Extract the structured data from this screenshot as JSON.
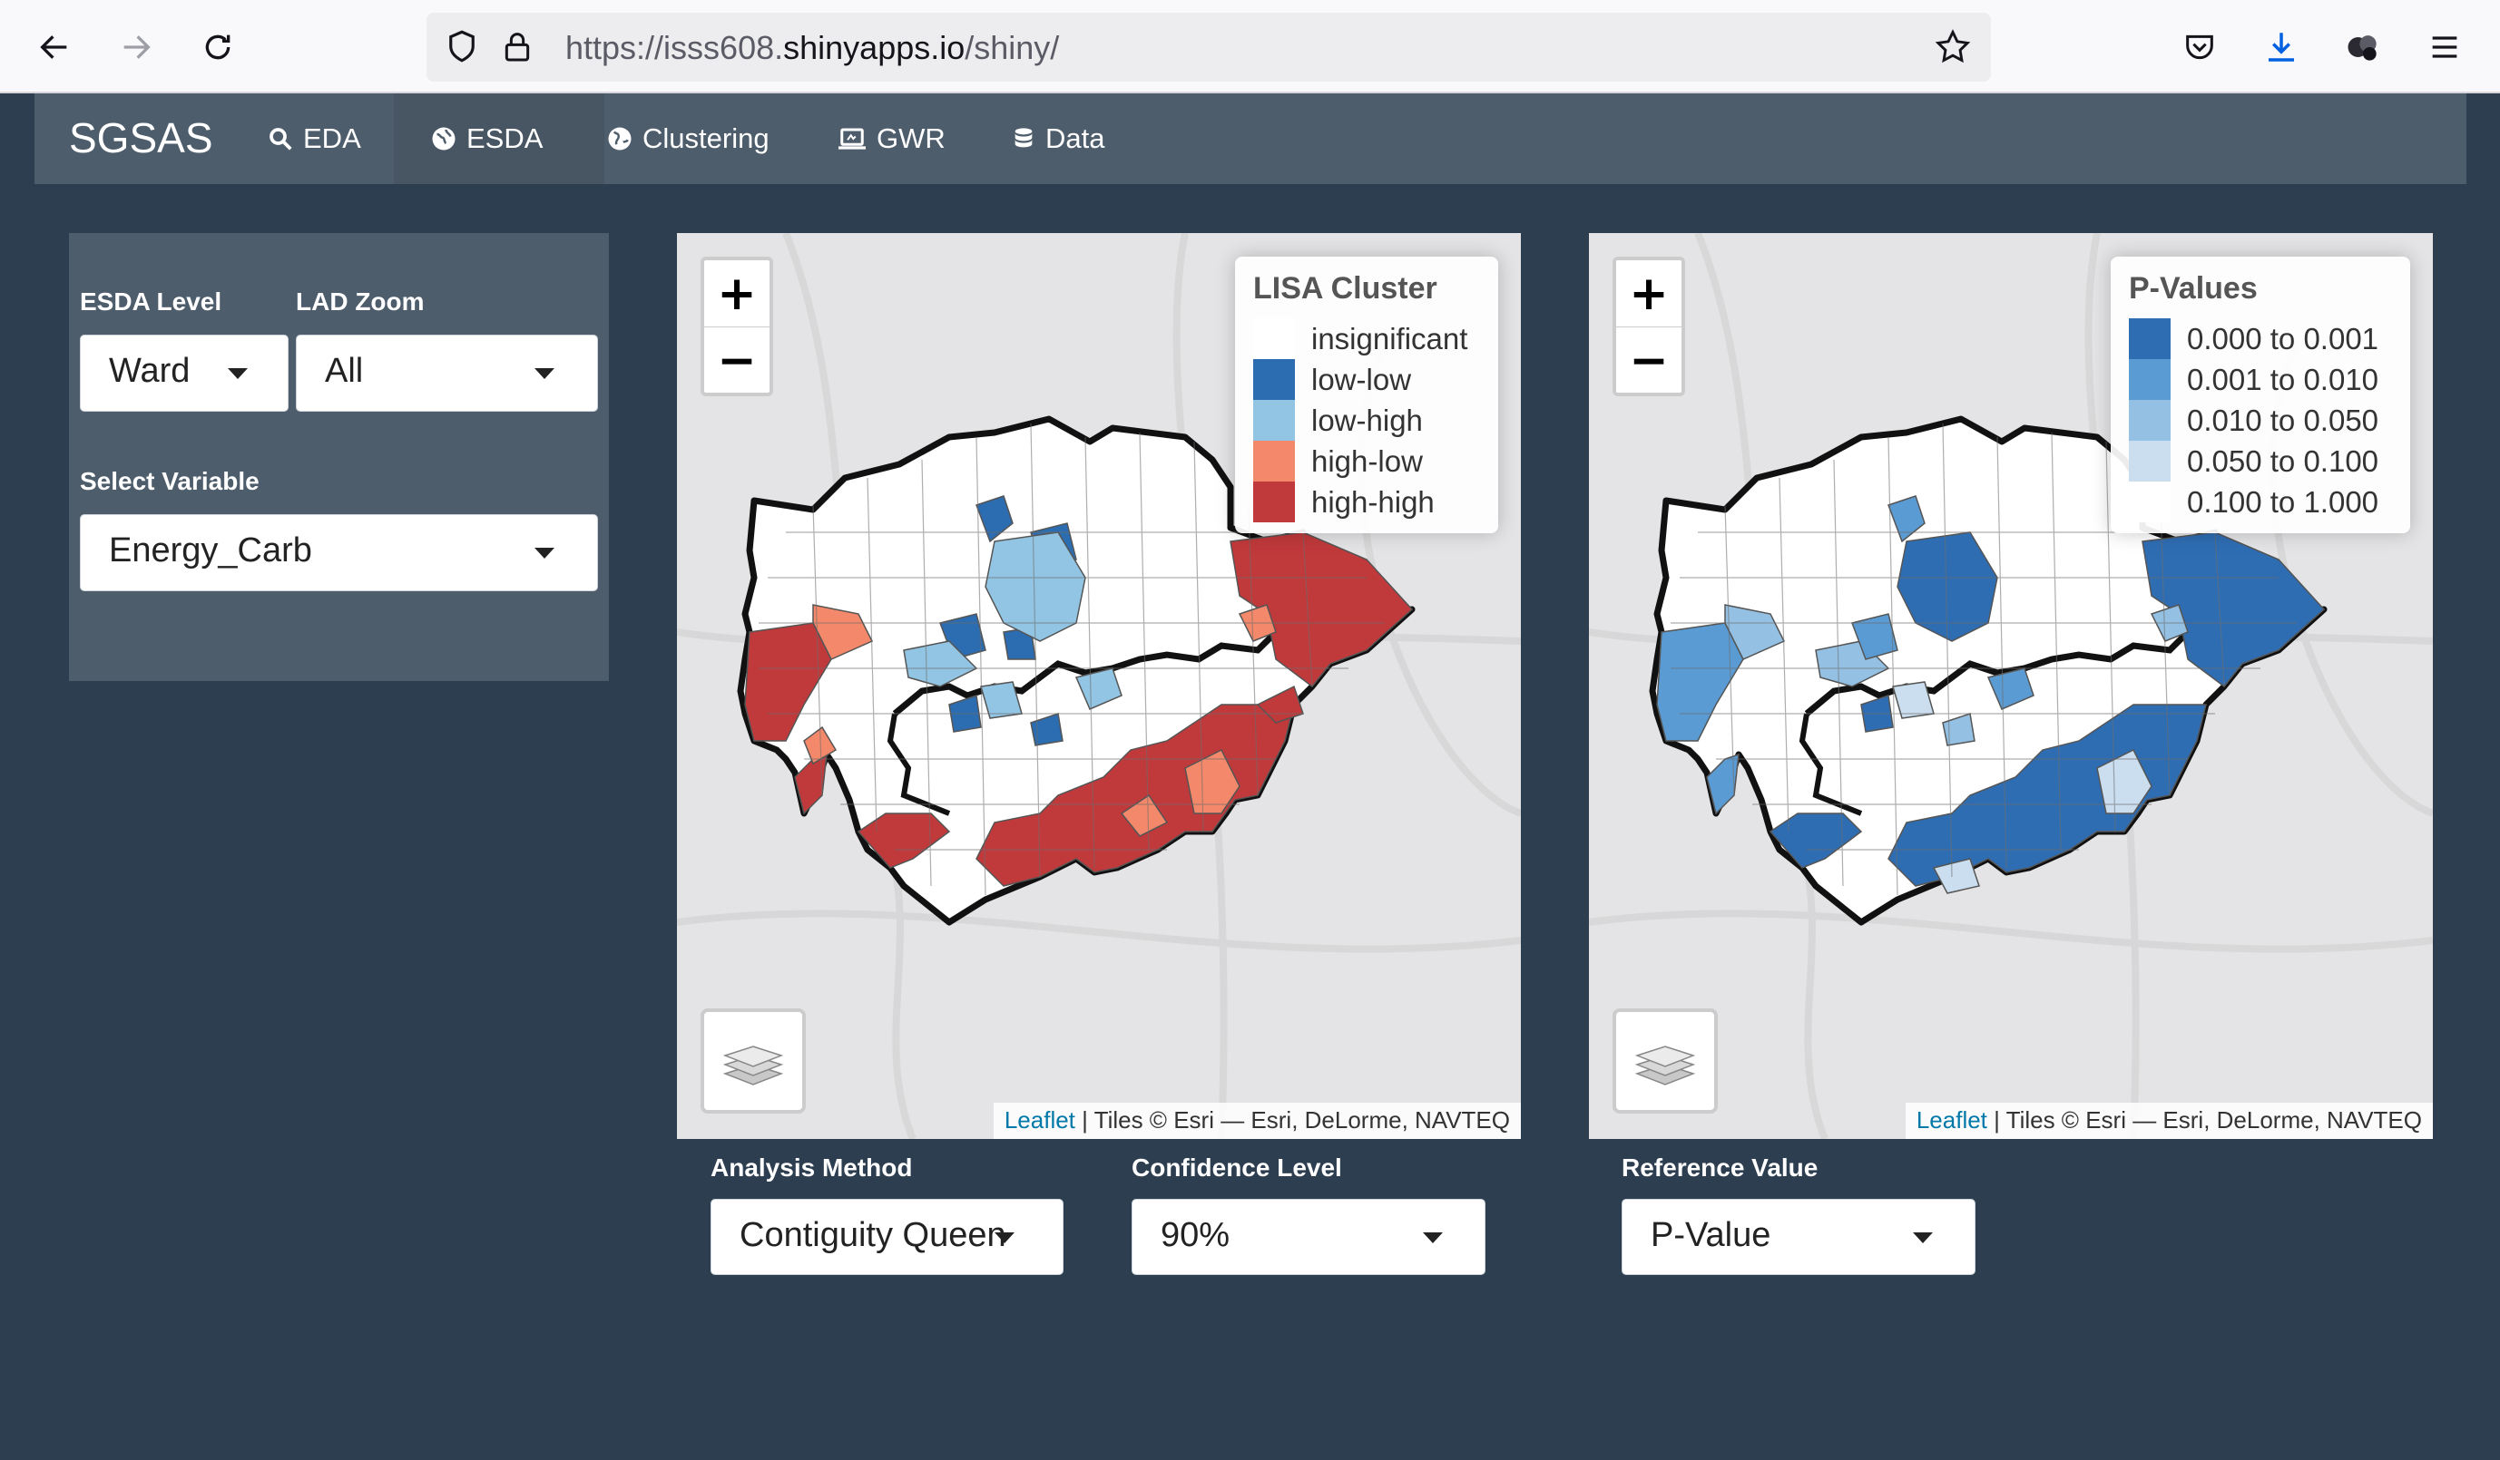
{
  "browser": {
    "url_prefix": "https://isss608.",
    "url_host": "shinyapps.io",
    "url_path": "/shiny/"
  },
  "navbar": {
    "brand": "SGSAS",
    "items": [
      {
        "label": "EDA",
        "icon": "search-icon"
      },
      {
        "label": "ESDA",
        "icon": "globe-icon",
        "active": true
      },
      {
        "label": "Clustering",
        "icon": "globe-americas-icon"
      },
      {
        "label": "GWR",
        "icon": "laptop-icon"
      },
      {
        "label": "Data",
        "icon": "database-icon"
      }
    ]
  },
  "sidebar": {
    "esda_level_label": "ESDA Level",
    "esda_level_value": "Ward",
    "lad_zoom_label": "LAD Zoom",
    "lad_zoom_value": "All",
    "variable_label": "Select Variable",
    "variable_value": "Energy_Carb"
  },
  "map_lisa": {
    "legend_title": "LISA Cluster",
    "legend": [
      {
        "label": "insignificant",
        "color": "#ffffff"
      },
      {
        "label": "low-low",
        "color": "#2c6cb0"
      },
      {
        "label": "low-high",
        "color": "#92c5e3"
      },
      {
        "label": "high-low",
        "color": "#f4886a"
      },
      {
        "label": "high-high",
        "color": "#c0393b"
      }
    ],
    "attribution_link": "Leaflet",
    "attribution_text": " | Tiles © Esri — Esri, DeLorme, NAVTEQ"
  },
  "map_pvalue": {
    "legend_title": "P-Values",
    "legend": [
      {
        "label": "0.000 to 0.001",
        "color": "#2f6db3"
      },
      {
        "label": "0.001 to 0.010",
        "color": "#5b9bd3"
      },
      {
        "label": "0.010 to 0.050",
        "color": "#94c1e3"
      },
      {
        "label": "0.050 to 0.100",
        "color": "#cadeef"
      },
      {
        "label": "0.100 to 1.000",
        "color": "#ffffff"
      }
    ],
    "attribution_link": "Leaflet",
    "attribution_text": " | Tiles © Esri — Esri, DeLorme, NAVTEQ"
  },
  "controls": {
    "analysis_method_label": "Analysis Method",
    "analysis_method_value": "Contiguity Queen",
    "confidence_label": "Confidence Level",
    "confidence_value": "90%",
    "reference_label": "Reference Value",
    "reference_value": "P-Value"
  },
  "zoom": {
    "plus": "+",
    "minus": "−"
  }
}
